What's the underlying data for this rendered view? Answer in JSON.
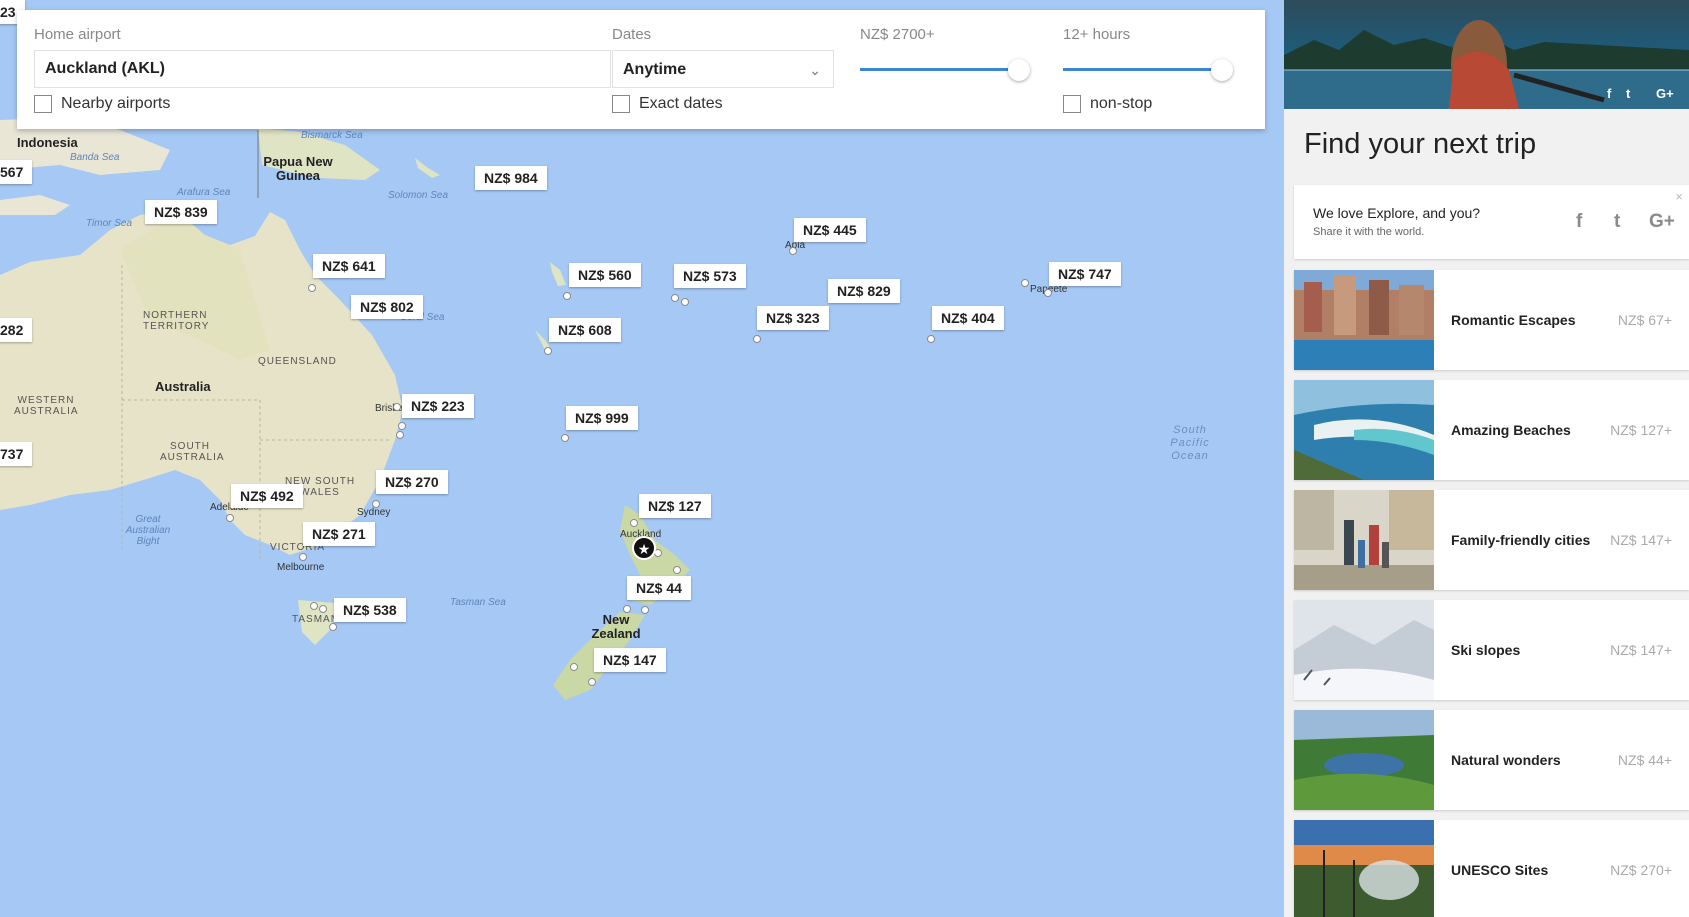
{
  "search": {
    "home_airport_label": "Home airport",
    "home_airport_value": "Auckland (AKL)",
    "nearby_airports_label": "Nearby airports",
    "dates_label": "Dates",
    "dates_value": "Anytime",
    "exact_dates_label": "Exact dates",
    "price_label": "NZ$ 2700+",
    "price_slider_fraction": 1.0,
    "duration_label": "12+ hours",
    "duration_slider_fraction": 1.0,
    "nonstop_label": "non-stop",
    "accent_color": "#3b86d0"
  },
  "map": {
    "sea_labels": [
      "Bismarck Sea",
      "Banda Sea",
      "Arafura Sea",
      "Timor Sea",
      "Solomon Sea",
      "Coral Sea",
      "Tasman Sea"
    ],
    "ocean_label": "South Pacific Ocean",
    "region_labels": [
      "NORTHERN TERRITORY",
      "QUEENSLAND",
      "WESTERN AUSTRALIA",
      "SOUTH AUSTRALIA",
      "NEW SOUTH WALES",
      "VICTORIA",
      "TASMANIA"
    ],
    "country_labels": [
      "Indonesia",
      "Papua New Guinea",
      "Australia",
      "New Zealand"
    ],
    "city_labels": [
      "Brisbane",
      "Sydney",
      "Melbourne",
      "Adelaide",
      "Auckland",
      "Great Australian Bight",
      "Apia",
      "Papeete"
    ],
    "prices": [
      "NZ$ 984",
      "NZ$ 839",
      "NZ$ 641",
      "NZ$ 802",
      "NZ$ 560",
      "NZ$ 573",
      "NZ$ 445",
      "NZ$ 829",
      "NZ$ 747",
      "NZ$ 608",
      "NZ$ 323",
      "NZ$ 404",
      "NZ$ 223",
      "NZ$ 999",
      "NZ$ 270",
      "NZ$ 492",
      "NZ$ 127",
      "NZ$ 271",
      "NZ$ 44",
      "NZ$ 538",
      "NZ$ 147"
    ],
    "edge_prices": [
      "23",
      "567",
      "282",
      "737"
    ]
  },
  "sidebar": {
    "title": "Find your next trip",
    "share": {
      "title": "We love Explore, and you?",
      "subtitle": "Share it with the world.",
      "close": "×"
    },
    "trips": [
      {
        "name": "Romantic Escapes",
        "price": "NZ$ 67+"
      },
      {
        "name": "Amazing Beaches",
        "price": "NZ$ 127+"
      },
      {
        "name": "Family-friendly cities",
        "price": "NZ$ 147+"
      },
      {
        "name": "Ski slopes",
        "price": "NZ$ 147+"
      },
      {
        "name": "Natural wonders",
        "price": "NZ$ 44+"
      },
      {
        "name": "UNESCO Sites",
        "price": "NZ$ 270+"
      }
    ]
  },
  "icons": {
    "facebook": "facebook-icon",
    "twitter": "twitter-icon",
    "google_plus": "google-plus-icon",
    "home_marker": "star-icon",
    "chevron": "chevron-down-icon"
  }
}
